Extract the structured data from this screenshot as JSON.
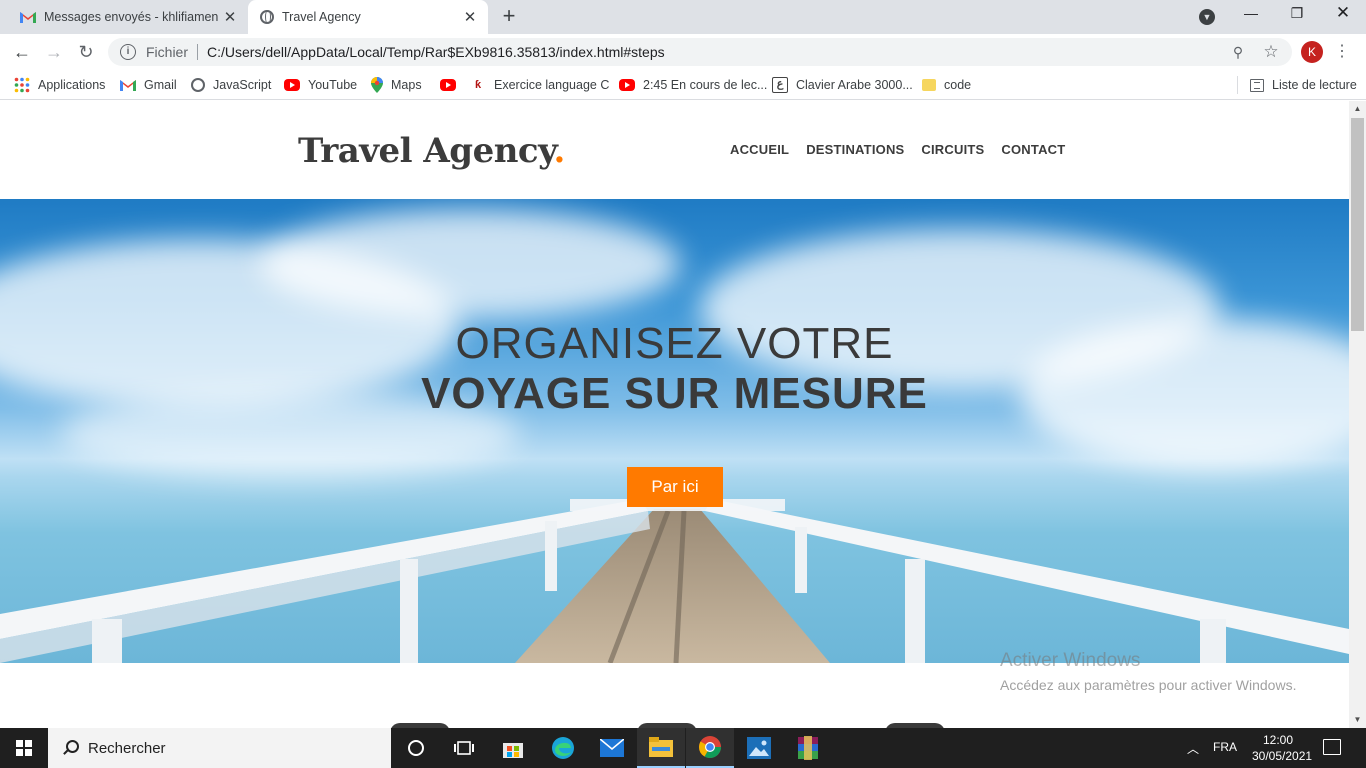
{
  "browser": {
    "tabs": [
      {
        "title": "Messages envoyés - khlifiameni@",
        "favicon": "gmail-icon",
        "active": false
      },
      {
        "title": "Travel Agency",
        "favicon": "globe-icon",
        "active": true
      }
    ],
    "new_tab_symbol": "+",
    "address": {
      "scheme_label": "Fichier",
      "url": "C:/Users/dell/AppData/Local/Temp/Rar$EXb9816.35813/index.html#steps"
    },
    "profile_initial": "K",
    "bookmarks": [
      {
        "label": "Applications",
        "icon": "apps-grid-icon"
      },
      {
        "label": "Gmail",
        "icon": "gmail-icon"
      },
      {
        "label": "JavaScript",
        "icon": "globe-icon"
      },
      {
        "label": "YouTube",
        "icon": "youtube-icon"
      },
      {
        "label": "Maps",
        "icon": "maps-pin-icon"
      },
      {
        "label": "",
        "icon": "youtube-icon"
      },
      {
        "label": "Exercice language C",
        "icon": "site-icon"
      },
      {
        "label": "2:45 En cours de lec...",
        "icon": "youtube-icon"
      },
      {
        "label": "Clavier Arabe 3000...",
        "icon": "clavier-icon"
      },
      {
        "label": "code",
        "icon": "folder-icon"
      }
    ],
    "reading_list_label": "Liste de lecture"
  },
  "site": {
    "logo_text": "Travel Agency",
    "logo_dot": ".",
    "nav": [
      "ACCUEIL",
      "DESTINATIONS",
      "CIRCUITS",
      "CONTACT"
    ],
    "hero": {
      "line1": "ORGANISEZ VOTRE",
      "line2": "VOYAGE SUR MESURE",
      "cta_label": "Par ici"
    },
    "accent_color": "#ff7a00"
  },
  "watermark": {
    "title": "Activer Windows",
    "subtitle": "Accédez aux paramètres pour activer Windows."
  },
  "taskbar": {
    "search_placeholder": "Rechercher",
    "apps": [
      "task-view-icon",
      "store-icon",
      "edge-icon",
      "mail-icon",
      "file-explorer-icon",
      "chrome-icon",
      "photos-icon",
      "winrar-icon"
    ],
    "language": "FRA",
    "time": "12:00",
    "date": "30/05/2021"
  }
}
